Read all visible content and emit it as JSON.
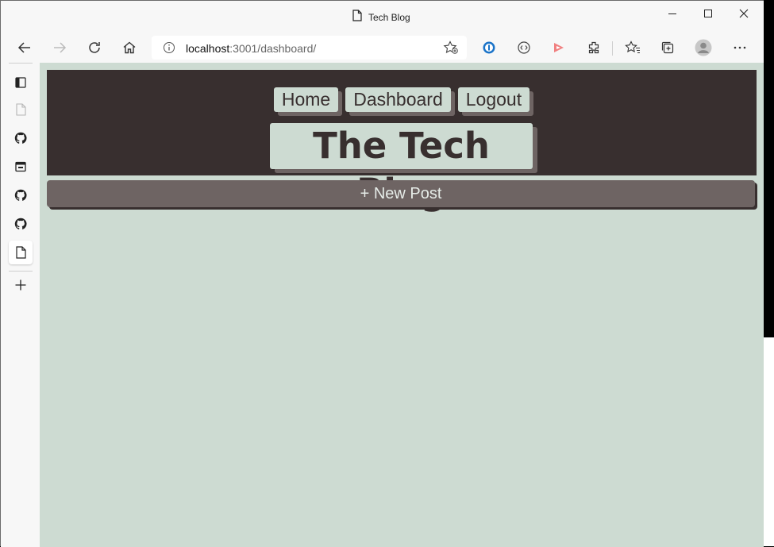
{
  "browser": {
    "tab_title": "Tech Blog",
    "url_host": "localhost",
    "url_rest": ":3001/dashboard/"
  },
  "site": {
    "nav": [
      "Home",
      "Dashboard",
      "Logout"
    ],
    "title": "The Tech Blog",
    "new_post_label": "+ New Post"
  },
  "colors": {
    "page_bg": "#cddbd2",
    "header_bg": "#382f2f",
    "button_bg": "#6e6463"
  }
}
